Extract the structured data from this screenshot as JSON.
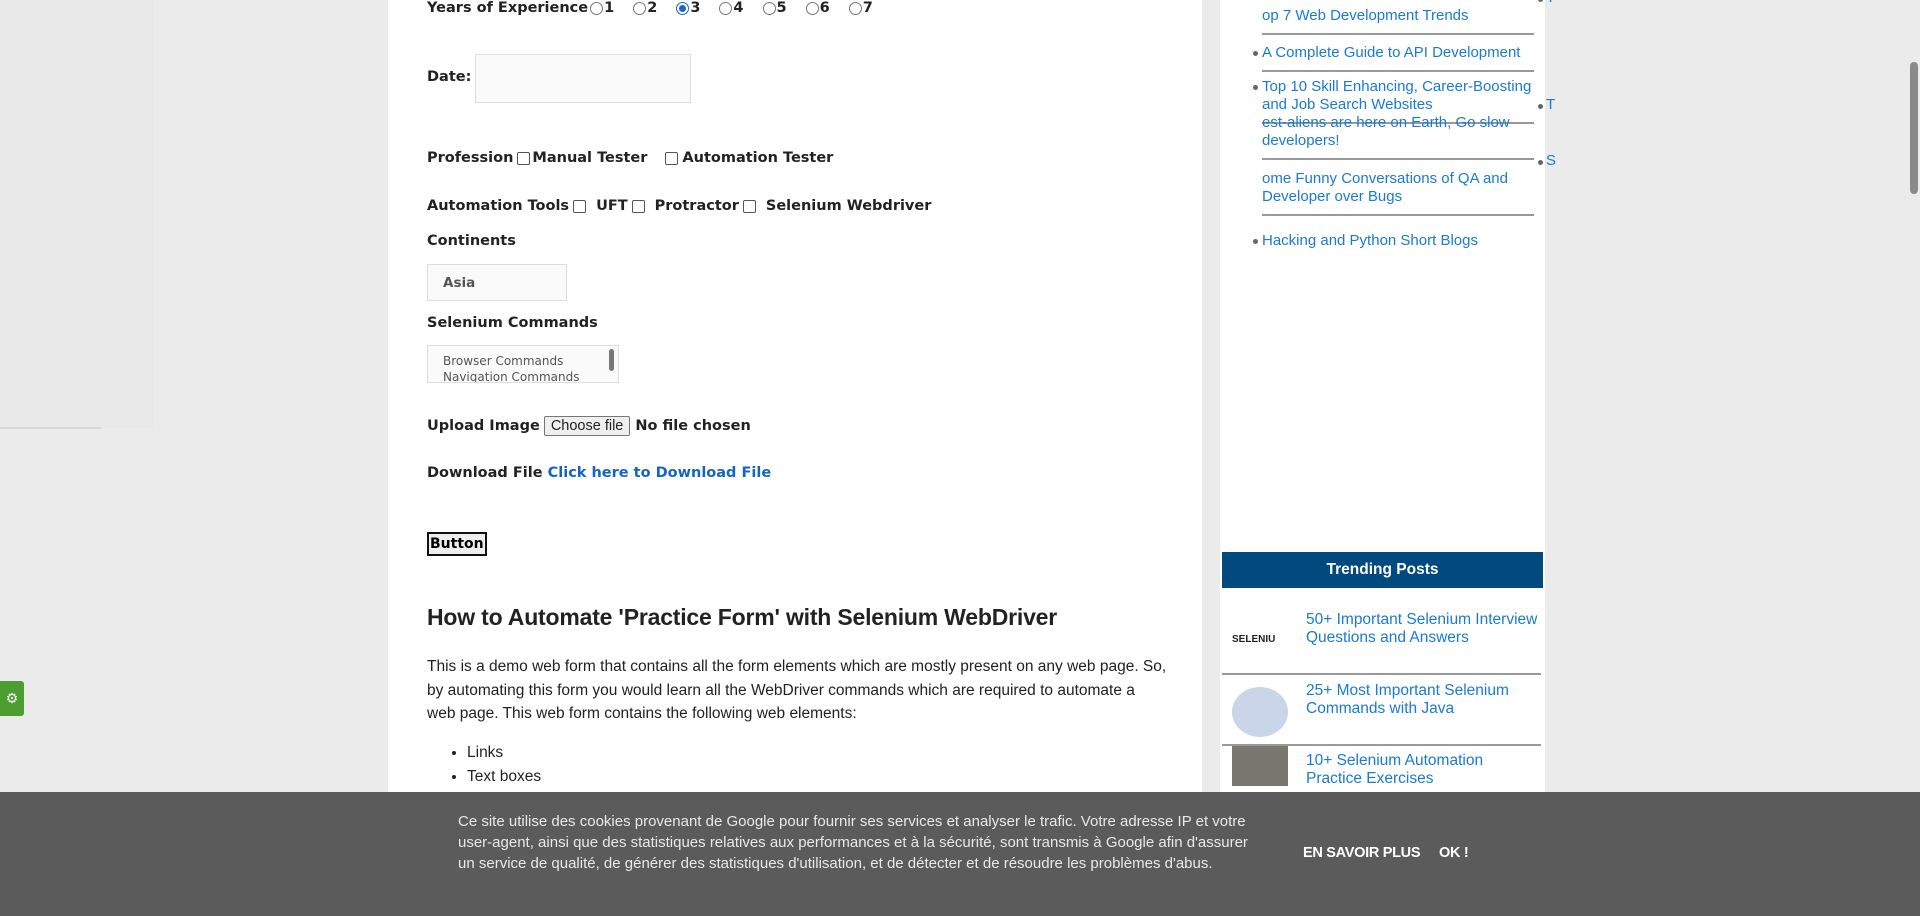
{
  "form": {
    "years_label": "Years of Experience",
    "years_options": [
      "1",
      "2",
      "3",
      "4",
      "5",
      "6",
      "7"
    ],
    "years_selected": "3",
    "date_label": "Date:",
    "date_value": "",
    "profession_label": "Profession",
    "profession_options": [
      "Manual Tester",
      "Automation Tester"
    ],
    "tools_label": "Automation Tools",
    "tools_options": [
      "UFT",
      "Protractor",
      "Selenium Webdriver"
    ],
    "continents_label": "Continents",
    "continents_selected": "Asia",
    "commands_label": "Selenium Commands",
    "commands_options": [
      "Browser Commands",
      "Navigation Commands"
    ],
    "upload_label": "Upload Image",
    "choose_file": "Choose file",
    "no_file": "No file chosen",
    "download_label": "Download File",
    "download_link": "Click here to Download File",
    "button_label": "Button"
  },
  "article": {
    "heading": "How to Automate 'Practice Form' with Selenium WebDriver",
    "paragraph": "This is a demo web form that contains all the form elements which are mostly present on any web page. So, by automating this form you would learn all the WebDriver commands which are required to automate a web page. This web form contains the following web elements:",
    "list": [
      "Links",
      "Text boxes"
    ]
  },
  "sidebar": {
    "posts": [
      {
        "lead": "T",
        "text": "op 7 Web Development Trends"
      },
      {
        "lead": "",
        "text": "A Complete Guide to API Development"
      },
      {
        "lead": "",
        "text": "Top 10 Skill Enhancing, Career-Boosting and Job Search Websites"
      },
      {
        "lead": "T",
        "text": "est-aliens are here on Earth, Go slow developers!"
      },
      {
        "lead": "S",
        "text": "ome Funny Conversations of QA and Developer over Bugs"
      },
      {
        "lead": "",
        "text": "Hacking and Python Short Blogs"
      }
    ],
    "trending_title": "Trending Posts",
    "trending": [
      {
        "title": "50+ Important Selenium Interview Questions and Answers",
        "thumb": "SELENIUM Interview Questions"
      },
      {
        "title": "25+ Most Important Selenium Commands with Java"
      },
      {
        "title": "10+ Selenium Automation Practice Exercises"
      }
    ]
  },
  "cookie": {
    "text": "Ce site utilise des cookies provenant de Google pour fournir ses services et analyser le trafic. Votre adresse IP et votre user-agent, ainsi que des statistiques relatives aux performances et à la sécurité, sont transmis à Google afin d'assurer un service de qualité, de générer des statistiques d'utilisation, et de détecter et de résoudre les problèmes d'abus.",
    "learn_more": "EN SAVOIR PLUS",
    "ok": "OK !"
  },
  "colors": {
    "accent": "#1a7ad4",
    "trending_header": "#004a7f",
    "settings_button": "#4c9e2f",
    "cookie_bg": "#5b5b5b"
  }
}
